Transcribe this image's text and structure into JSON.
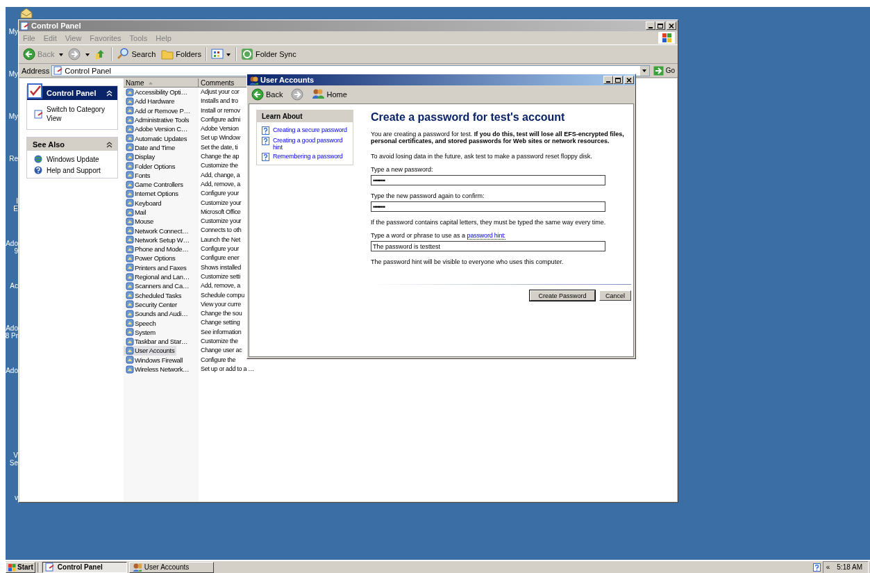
{
  "desktop": {
    "icon_labels": [
      {
        "lines": [
          "My"
        ]
      },
      {
        "lines": [
          "My"
        ]
      },
      {
        "lines": [
          "My"
        ]
      },
      {
        "lines": [
          "Re"
        ]
      },
      {
        "lines": [
          "I",
          "E"
        ]
      },
      {
        "lines": [
          "Ado",
          "9"
        ]
      },
      {
        "lines": [
          "Ac"
        ]
      },
      {
        "lines": [
          "Ado",
          "8 Pr"
        ]
      },
      {
        "lines": [
          "Ado"
        ]
      },
      {
        "lines": [
          "V",
          "Se"
        ]
      },
      {
        "lines": [
          "v"
        ]
      }
    ]
  },
  "control_panel": {
    "title": "Control Panel",
    "menu": [
      "File",
      "Edit",
      "View",
      "Favorites",
      "Tools",
      "Help"
    ],
    "toolbar": {
      "back": "Back",
      "search": "Search",
      "folders": "Folders",
      "folder_sync": "Folder Sync"
    },
    "address": {
      "label": "Address",
      "value": "Control Panel",
      "go": "Go"
    },
    "sidebar": [
      {
        "title": "Control Panel",
        "kind": "main",
        "items": [
          "Switch to Category View"
        ]
      },
      {
        "title": "See Also",
        "kind": "plain",
        "items": [
          "Windows Update",
          "Help and Support"
        ]
      }
    ],
    "columns": [
      {
        "label": "Name",
        "sorted": true
      },
      {
        "label": "Comments",
        "sorted": false
      }
    ],
    "rows": [
      {
        "name": "Accessibility Opti…",
        "comment": "Adjust your cor",
        "selected": false
      },
      {
        "name": "Add Hardware",
        "comment": "Installs and tro",
        "selected": false
      },
      {
        "name": "Add or Remove P…",
        "comment": "Install or remov",
        "selected": false
      },
      {
        "name": "Administrative Tools",
        "comment": "Configure admi",
        "selected": false
      },
      {
        "name": "Adobe Version C…",
        "comment": "Adobe Version",
        "selected": false
      },
      {
        "name": "Automatic Updates",
        "comment": "Set up Window",
        "selected": false
      },
      {
        "name": "Date and Time",
        "comment": "Set the date, ti",
        "selected": false
      },
      {
        "name": "Display",
        "comment": "Change the ap",
        "selected": false
      },
      {
        "name": "Folder Options",
        "comment": "Customize the",
        "selected": false
      },
      {
        "name": "Fonts",
        "comment": "Add, change, a",
        "selected": false
      },
      {
        "name": "Game Controllers",
        "comment": "Add, remove, a",
        "selected": false
      },
      {
        "name": "Internet Options",
        "comment": "Configure your",
        "selected": false
      },
      {
        "name": "Keyboard",
        "comment": "Customize your",
        "selected": false
      },
      {
        "name": "Mail",
        "comment": "Microsoft Office",
        "selected": false
      },
      {
        "name": "Mouse",
        "comment": "Customize your",
        "selected": false
      },
      {
        "name": "Network Connect…",
        "comment": "Connects to oth",
        "selected": false
      },
      {
        "name": "Network Setup W…",
        "comment": "Launch the Net",
        "selected": false
      },
      {
        "name": "Phone and Mode…",
        "comment": "Configure your",
        "selected": false
      },
      {
        "name": "Power Options",
        "comment": "Configure ener",
        "selected": false
      },
      {
        "name": "Printers and Faxes",
        "comment": "Shows installed",
        "selected": false
      },
      {
        "name": "Regional and Lan…",
        "comment": "Customize setti",
        "selected": false
      },
      {
        "name": "Scanners and Ca…",
        "comment": "Add, remove, a",
        "selected": false
      },
      {
        "name": "Scheduled Tasks",
        "comment": "Schedule compu",
        "selected": false
      },
      {
        "name": "Security Center",
        "comment": "View your curre",
        "selected": false
      },
      {
        "name": "Sounds and Audi…",
        "comment": "Change the sou",
        "selected": false
      },
      {
        "name": "Speech",
        "comment": "Change setting",
        "selected": false
      },
      {
        "name": "System",
        "comment": "See information",
        "selected": false
      },
      {
        "name": "Taskbar and Star…",
        "comment": "Customize the",
        "selected": false
      },
      {
        "name": "User Accounts",
        "comment": "Change user ac",
        "selected": true
      },
      {
        "name": "Windows Firewall",
        "comment": "Configure the",
        "selected": false
      },
      {
        "name": "Wireless Network…",
        "comment": "Set up or add to a …",
        "selected": false
      }
    ]
  },
  "user_accounts": {
    "title": "User Accounts",
    "nav": {
      "back": "Back",
      "home": "Home"
    },
    "learn_about": {
      "title": "Learn About",
      "links": [
        "Creating a secure password",
        "Creating a good password hint",
        "Remembering a password"
      ]
    },
    "heading": "Create a password for test's account",
    "intro": "You are creating a password for test. **If you do this, test will lose all EFS-encrypted files, personal certificates, and stored passwords for Web sites or network resources.**",
    "advice": "To avoid losing data in the future, ask test to make a password reset floppy disk.",
    "fields": [
      {
        "label": "Type a new password:",
        "value": "••••••••"
      },
      {
        "label": "Type the new password again to confirm:",
        "value": "••••••••"
      }
    ],
    "caps_note": "If the password contains capital letters, they must be typed the same way every time.",
    "hint": {
      "label": "Type a word or phrase to use as a",
      "link": "password hint:",
      "value": "The password is testtest"
    },
    "hint_note": "The password hint will be visible to everyone who uses this computer.",
    "buttons": [
      {
        "label": "Create Password",
        "default": true
      },
      {
        "label": "Cancel",
        "default": false
      }
    ]
  },
  "taskbar": {
    "start": "Start",
    "tasks": [
      {
        "label": "Control Panel",
        "selected": true
      },
      {
        "label": "User Accounts",
        "selected": false
      }
    ],
    "tray_toggle": "«",
    "clock": "5:18 AM"
  }
}
